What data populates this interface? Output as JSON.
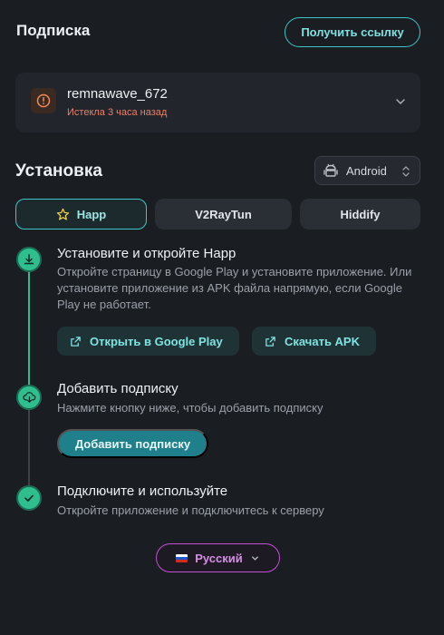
{
  "header": {
    "title": "Подписка",
    "get_link_label": "Получить ссылку"
  },
  "subscription": {
    "name": "remnawave_672",
    "status": "Истекла 3 часа назад",
    "status_color": "#e8806a"
  },
  "install": {
    "title": "Установка",
    "platform": "Android",
    "apps": [
      {
        "label": "Happ",
        "active": true
      },
      {
        "label": "V2RayTun",
        "active": false
      },
      {
        "label": "Hiddify",
        "active": false
      }
    ],
    "steps": [
      {
        "title": "Установите и откройте Happ",
        "description": "Откройте страницу в Google Play и установите приложение. Или установите приложение из APK файла напрямую, если Google Play не работает.",
        "buttons": [
          "Открыть в Google Play",
          "Скачать APK"
        ],
        "icon": "download-icon"
      },
      {
        "title": "Добавить подписку",
        "description": "Нажмите кнопку ниже, чтобы добавить подписку",
        "button": "Добавить подписку",
        "icon": "cloud-download-icon"
      },
      {
        "title": "Подключите и используйте",
        "description": "Откройте приложение и подключитесь к серверу",
        "icon": "check-icon"
      }
    ]
  },
  "language": {
    "label": "Русский",
    "flag_colors": [
      "#ffffff",
      "#1c57c7",
      "#d52b1e"
    ]
  },
  "colors": {
    "accent": "#3ec6c6",
    "step_done": "#2fbf8f",
    "language_border": "#c24fd6"
  }
}
